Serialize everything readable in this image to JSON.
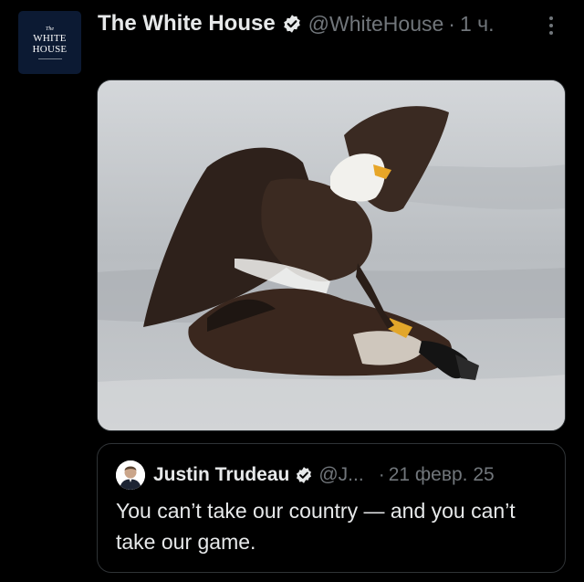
{
  "post": {
    "avatar": {
      "line1": "The",
      "line2": "WHITE",
      "line3": "HOUSE"
    },
    "author_name": "The White House",
    "handle": "@WhiteHouse",
    "separator": "·",
    "time": "1 ч.",
    "verified_icon": "verified-badge-icon",
    "more_icon": "more-vertical-icon",
    "media_description_icon": "bald-eagle-photo"
  },
  "quote": {
    "author_name": "Justin Trudeau",
    "handle": "@J...",
    "separator": "·",
    "date": "21 февр. 25",
    "text": "You can’t take our country — and you can’t take our game.",
    "verified_icon": "verified-badge-icon"
  },
  "colors": {
    "background": "#000000",
    "primary_text": "#e7e9ea",
    "secondary_text": "#71767b",
    "border": "#2f3336",
    "verified_badge": "#e7e9ea",
    "avatar_bg": "#0c1a33"
  }
}
